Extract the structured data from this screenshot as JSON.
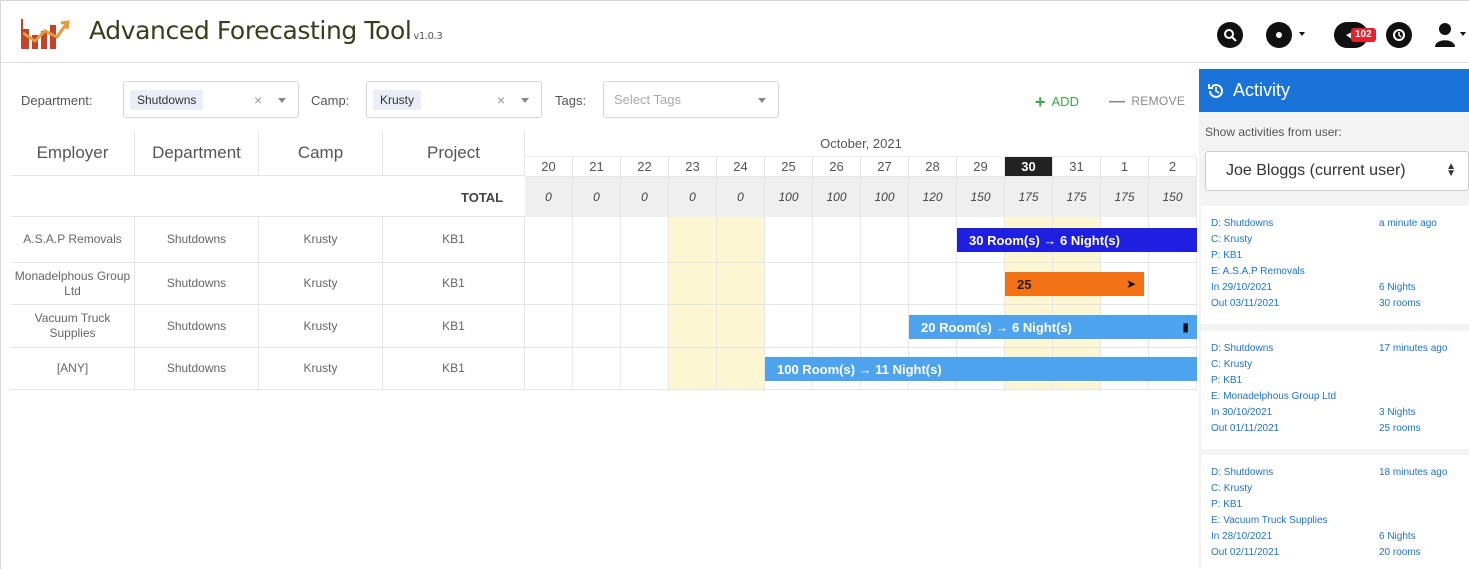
{
  "header": {
    "title": "Advanced Forecasting Tool",
    "version": "v1.0.3",
    "icons": [
      "search-icon",
      "gear-icon",
      "notification-icon",
      "history-icon",
      "user-icon"
    ],
    "notification_count": "102"
  },
  "filters": {
    "department_label": "Department:",
    "department_value": "Shutdowns",
    "camp_label": "Camp:",
    "camp_value": "Krusty",
    "tags_label": "Tags:",
    "tags_placeholder": "Select Tags",
    "clear_glyph": "×",
    "add_label": "ADD",
    "remove_label": "REMOVE"
  },
  "grid": {
    "columns": [
      "Employer",
      "Department",
      "Camp",
      "Project"
    ],
    "month": "October, 2021",
    "days": [
      "20",
      "21",
      "22",
      "23",
      "24",
      "25",
      "26",
      "27",
      "28",
      "29",
      "30",
      "31",
      "1",
      "2"
    ],
    "today": "30",
    "total_label": "TOTAL",
    "totals": [
      "0",
      "0",
      "0",
      "0",
      "0",
      "100",
      "100",
      "100",
      "120",
      "150",
      "175",
      "175",
      "175",
      "150"
    ],
    "rows": [
      {
        "employer": "A.S.A.P Removals",
        "department": "Shutdowns",
        "camp": "Krusty",
        "project": "KB1"
      },
      {
        "employer": "Monadelphous Group Ltd",
        "department": "Shutdowns",
        "camp": "Krusty",
        "project": "KB1"
      },
      {
        "employer": "Vacuum Truck Supplies",
        "department": "Shutdowns",
        "camp": "Krusty",
        "project": "KB1"
      },
      {
        "employer": "[ANY]",
        "department": "Shutdowns",
        "camp": "Krusty",
        "project": "KB1"
      }
    ],
    "bars": [
      {
        "label": "30 Room(s) → 6 Night(s)",
        "color": "#1f1fe0"
      },
      {
        "label": "25",
        "color": "#f47216"
      },
      {
        "label": "20 Room(s) → 6 Night(s)",
        "color": "#4da3ee"
      },
      {
        "label": "100 Room(s) → 11 Night(s)",
        "color": "#4da3ee"
      }
    ]
  },
  "activity": {
    "title": "Activity",
    "show_label": "Show activities from user:",
    "user": "Joe Bloggs (current user)",
    "items": [
      {
        "d": "D: Shutdowns",
        "c": "C: Krusty",
        "p": "P: KB1",
        "e": "E: A.S.A.P Removals",
        "in": "In 29/10/2021",
        "out": "Out 03/11/2021",
        "time": "a minute ago",
        "nights": "6 Nights",
        "rooms": "30 rooms"
      },
      {
        "d": "D: Shutdowns",
        "c": "C: Krusty",
        "p": "P: KB1",
        "e": "E: Monadelphous Group Ltd",
        "in": "In 30/10/2021",
        "out": "Out 01/11/2021",
        "time": "17 minutes ago",
        "nights": "3 Nights",
        "rooms": "25 rooms"
      },
      {
        "d": "D: Shutdowns",
        "c": "C: Krusty",
        "p": "P: KB1",
        "e": "E: Vacuum Truck Supplies",
        "in": "In 28/10/2021",
        "out": "Out 02/11/2021",
        "time": "18 minutes ago",
        "nights": "6 Nights",
        "rooms": "20 rooms"
      }
    ]
  },
  "colors": {
    "accent": "#1a73d9",
    "weekend": "#fdf6d2",
    "add": "#3aa84a",
    "badge": "#e8202a"
  }
}
